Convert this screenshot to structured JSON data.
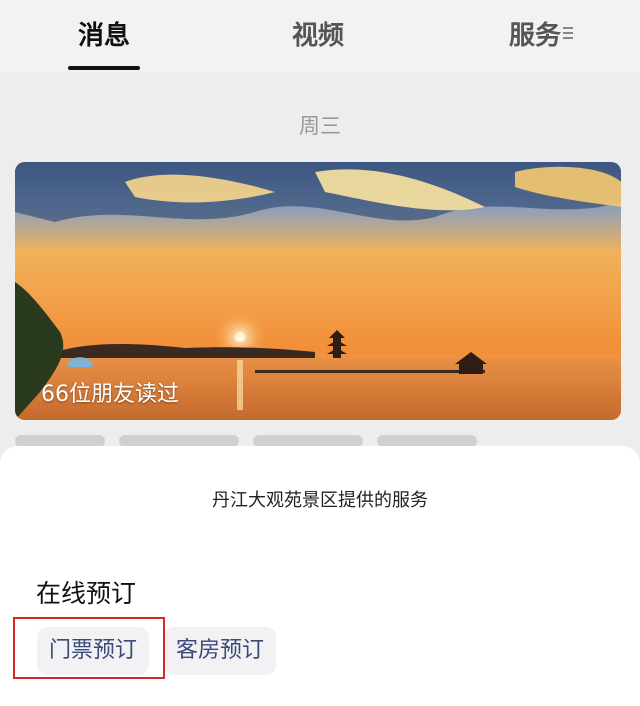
{
  "tabs": [
    {
      "label": "消息",
      "active": true
    },
    {
      "label": "视频",
      "active": false
    },
    {
      "label": "服务",
      "active": false
    }
  ],
  "feed": {
    "day_label": "周三",
    "article": {
      "read_count": "66位朋友读过",
      "image_icon": "sunset-lake-pagoda-image"
    }
  },
  "sheet": {
    "title": "丹江大观苑景区提供的服务",
    "section_title": "在线预订",
    "services": [
      {
        "label": "门票预订",
        "highlighted": true
      },
      {
        "label": "客房预订",
        "highlighted": false
      }
    ]
  },
  "colors": {
    "accent_text": "#3b4a78",
    "highlight": "#d62828"
  }
}
